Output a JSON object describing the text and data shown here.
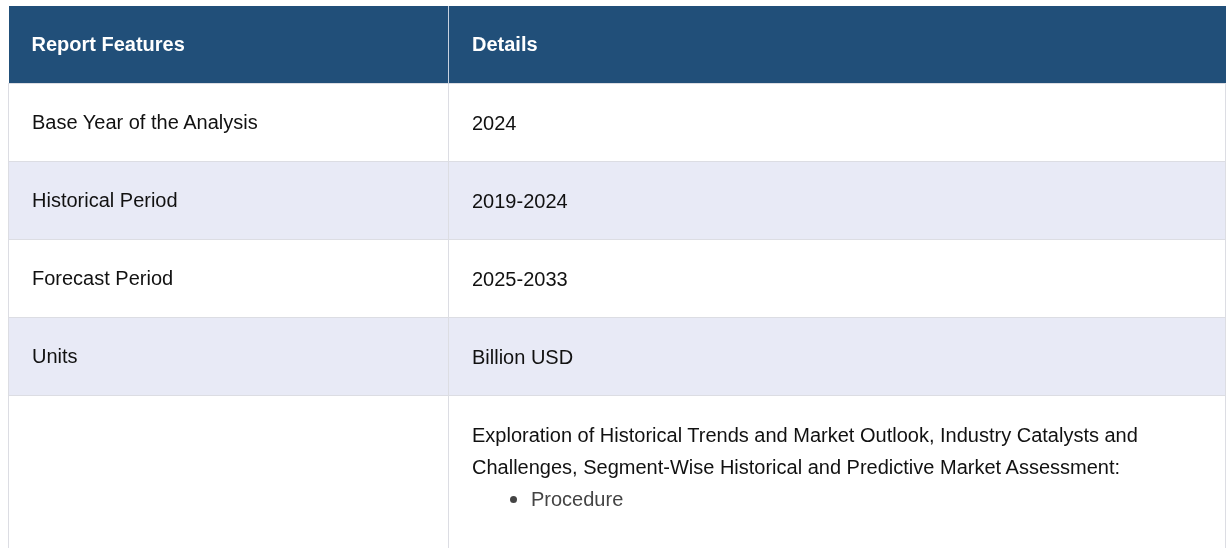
{
  "table": {
    "columns": [
      "Report Features",
      "Details"
    ],
    "rows": [
      {
        "feature": "Base Year of the Analysis",
        "details": "2024"
      },
      {
        "feature": "Historical Period",
        "details": "2019-2024"
      },
      {
        "feature": "Forecast Period",
        "details": "2025-2033"
      },
      {
        "feature": "Units",
        "details": "Billion USD"
      },
      {
        "feature": "",
        "details": "Exploration of Historical Trends and Market Outlook, Industry Catalysts and Challenges, Segment-Wise Historical and Predictive Market Assessment:",
        "items": [
          "Procedure"
        ]
      }
    ]
  }
}
